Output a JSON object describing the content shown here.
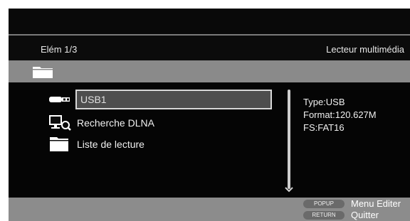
{
  "header": {
    "item_counter": "Elém 1/3",
    "player_title": "Lecteur multimédia"
  },
  "pathbar": {
    "icon": "folder-icon"
  },
  "list": {
    "items": [
      {
        "label": "USB1",
        "icon": "usb-icon",
        "selected": true
      },
      {
        "label": "Recherche DLNA",
        "icon": "network-search-icon",
        "selected": false
      },
      {
        "label": "Liste de lecture",
        "icon": "folder-icon",
        "selected": false
      }
    ]
  },
  "info": {
    "type": "Type:USB",
    "format": "Format:120.627M",
    "fs": "FS:FAT16"
  },
  "footer": {
    "popup_key": "POPUP",
    "popup_action": "Menu Editer",
    "return_key": "RETURN",
    "return_action": "Quitter"
  },
  "colors": {
    "background": "#0b0b0b",
    "bar_gray": "#8a8a8a",
    "selection_fill": "#4e4e4e",
    "selection_border": "#d8d8d8",
    "text": "#f0f0f0"
  }
}
